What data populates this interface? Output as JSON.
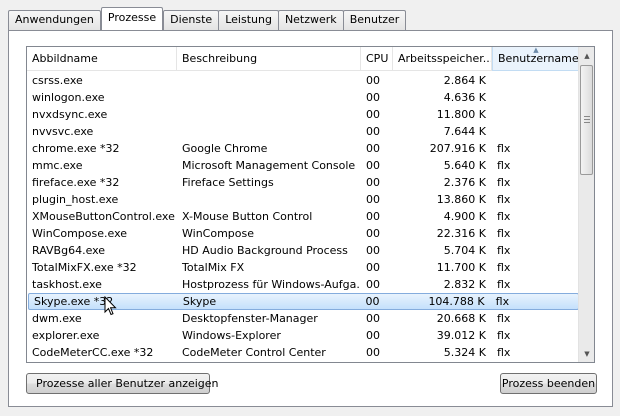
{
  "tabs": [
    {
      "label": "Anwendungen"
    },
    {
      "label": "Prozesse"
    },
    {
      "label": "Dienste"
    },
    {
      "label": "Leistung"
    },
    {
      "label": "Netzwerk"
    },
    {
      "label": "Benutzer"
    }
  ],
  "active_tab": "Prozesse",
  "columns": {
    "image": "Abbildname",
    "description": "Beschreibung",
    "cpu": "CPU",
    "memory": "Arbeitsspeicher...",
    "user": "Benutzername"
  },
  "sorted_column": "user",
  "rows": [
    {
      "image": "csrss.exe",
      "description": "",
      "cpu": "00",
      "memory": "2.864 K",
      "user": ""
    },
    {
      "image": "winlogon.exe",
      "description": "",
      "cpu": "00",
      "memory": "4.636 K",
      "user": ""
    },
    {
      "image": "nvxdsync.exe",
      "description": "",
      "cpu": "00",
      "memory": "11.800 K",
      "user": ""
    },
    {
      "image": "nvvsvc.exe",
      "description": "",
      "cpu": "00",
      "memory": "7.644 K",
      "user": ""
    },
    {
      "image": "chrome.exe *32",
      "description": "Google Chrome",
      "cpu": "00",
      "memory": "207.916 K",
      "user": "flx"
    },
    {
      "image": "mmc.exe",
      "description": "Microsoft Management Console",
      "cpu": "00",
      "memory": "5.640 K",
      "user": "flx"
    },
    {
      "image": "fireface.exe *32",
      "description": "Fireface Settings",
      "cpu": "00",
      "memory": "2.376 K",
      "user": "flx"
    },
    {
      "image": "plugin_host.exe",
      "description": "",
      "cpu": "00",
      "memory": "13.860 K",
      "user": "flx"
    },
    {
      "image": "XMouseButtonControl.exe",
      "description": "X-Mouse Button Control",
      "cpu": "00",
      "memory": "4.900 K",
      "user": "flx"
    },
    {
      "image": "WinCompose.exe",
      "description": "WinCompose",
      "cpu": "00",
      "memory": "22.316 K",
      "user": "flx"
    },
    {
      "image": "RAVBg64.exe",
      "description": "HD Audio Background Process",
      "cpu": "00",
      "memory": "5.704 K",
      "user": "flx"
    },
    {
      "image": "TotalMixFX.exe *32",
      "description": "TotalMix FX",
      "cpu": "00",
      "memory": "11.700 K",
      "user": "flx"
    },
    {
      "image": "taskhost.exe",
      "description": "Hostprozess für Windows-Aufga...",
      "cpu": "00",
      "memory": "2.832 K",
      "user": "flx"
    },
    {
      "image": "Skype.exe *32",
      "description": "Skype",
      "cpu": "00",
      "memory": "104.788 K",
      "user": "flx",
      "selected": true
    },
    {
      "image": "dwm.exe",
      "description": "Desktopfenster-Manager",
      "cpu": "00",
      "memory": "20.668 K",
      "user": "flx"
    },
    {
      "image": "explorer.exe",
      "description": "Windows-Explorer",
      "cpu": "00",
      "memory": "39.012 K",
      "user": "flx"
    },
    {
      "image": "CodeMeterCC.exe *32",
      "description": "CodeMeter Control Center",
      "cpu": "00",
      "memory": "5.324 K",
      "user": "flx"
    }
  ],
  "buttons": {
    "show_all": "Prozesse aller Benutzer anzeigen",
    "end_process": "Prozess beenden"
  },
  "icons": {
    "shield": "uac-shield-icon",
    "cursor": "mouse-pointer-icon"
  },
  "colors": {
    "selection_border": "#84acdd",
    "selection_fill": "#c4e0fc",
    "sorted_header": "#eaf3fc"
  }
}
